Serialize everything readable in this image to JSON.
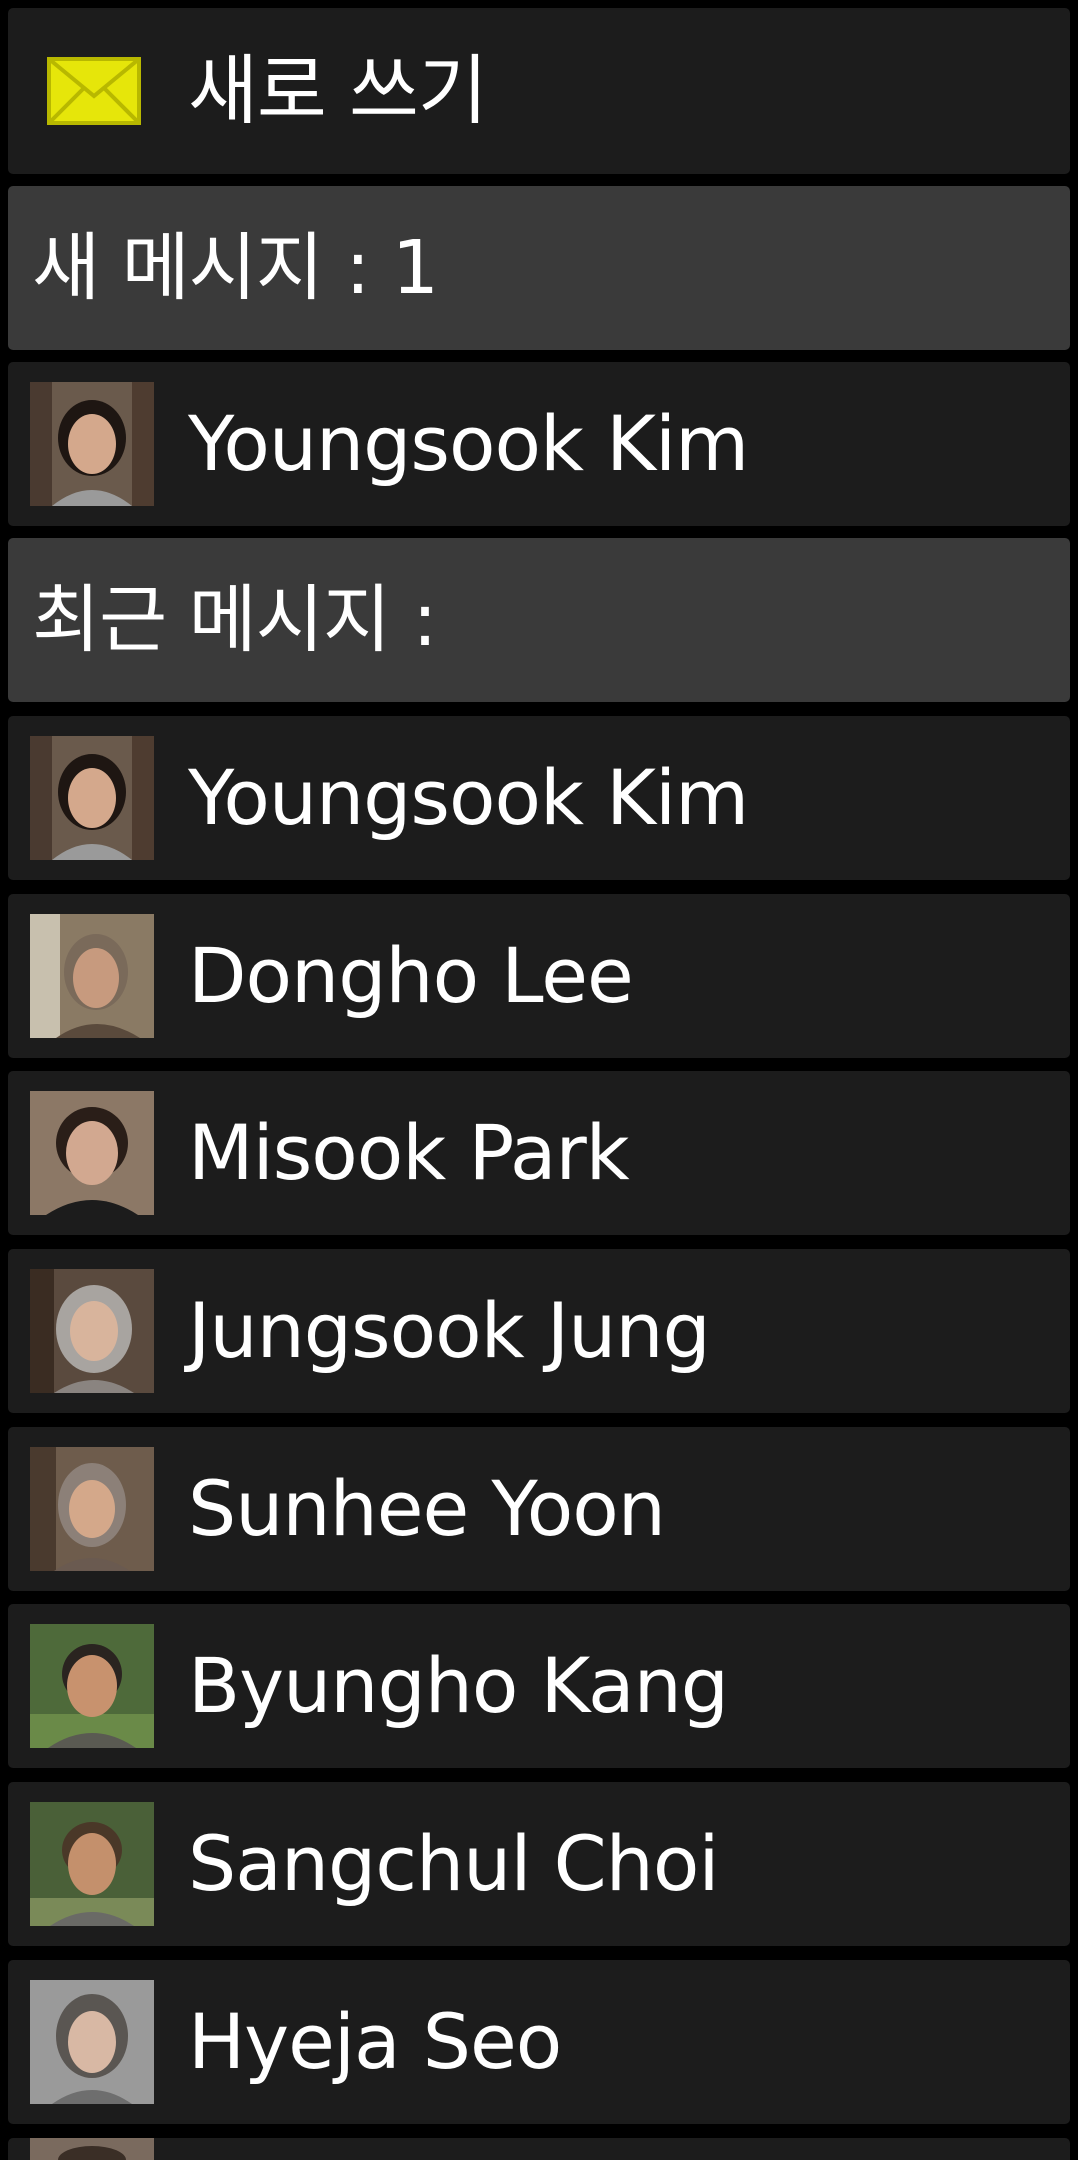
{
  "compose": {
    "label": "새로 쓰기",
    "icon": "envelope-icon",
    "icon_color": "#e6e60a"
  },
  "new_messages": {
    "label": "새 메시지 : 1",
    "items": [
      {
        "name": "Youngsook Kim"
      }
    ]
  },
  "recent_messages": {
    "label": "최근 메시지 :",
    "items": [
      {
        "name": "Youngsook Kim"
      },
      {
        "name": "Dongho Lee"
      },
      {
        "name": "Misook Park"
      },
      {
        "name": "Jungsook Jung"
      },
      {
        "name": "Sunhee Yoon"
      },
      {
        "name": "Byungho Kang"
      },
      {
        "name": "Sangchul Choi"
      },
      {
        "name": "Hyeja Seo"
      }
    ]
  },
  "colors": {
    "row_background": "#1c1c1c",
    "section_header_background": "#3a3a3a",
    "page_background": "#000000",
    "text": "#ffffff"
  }
}
